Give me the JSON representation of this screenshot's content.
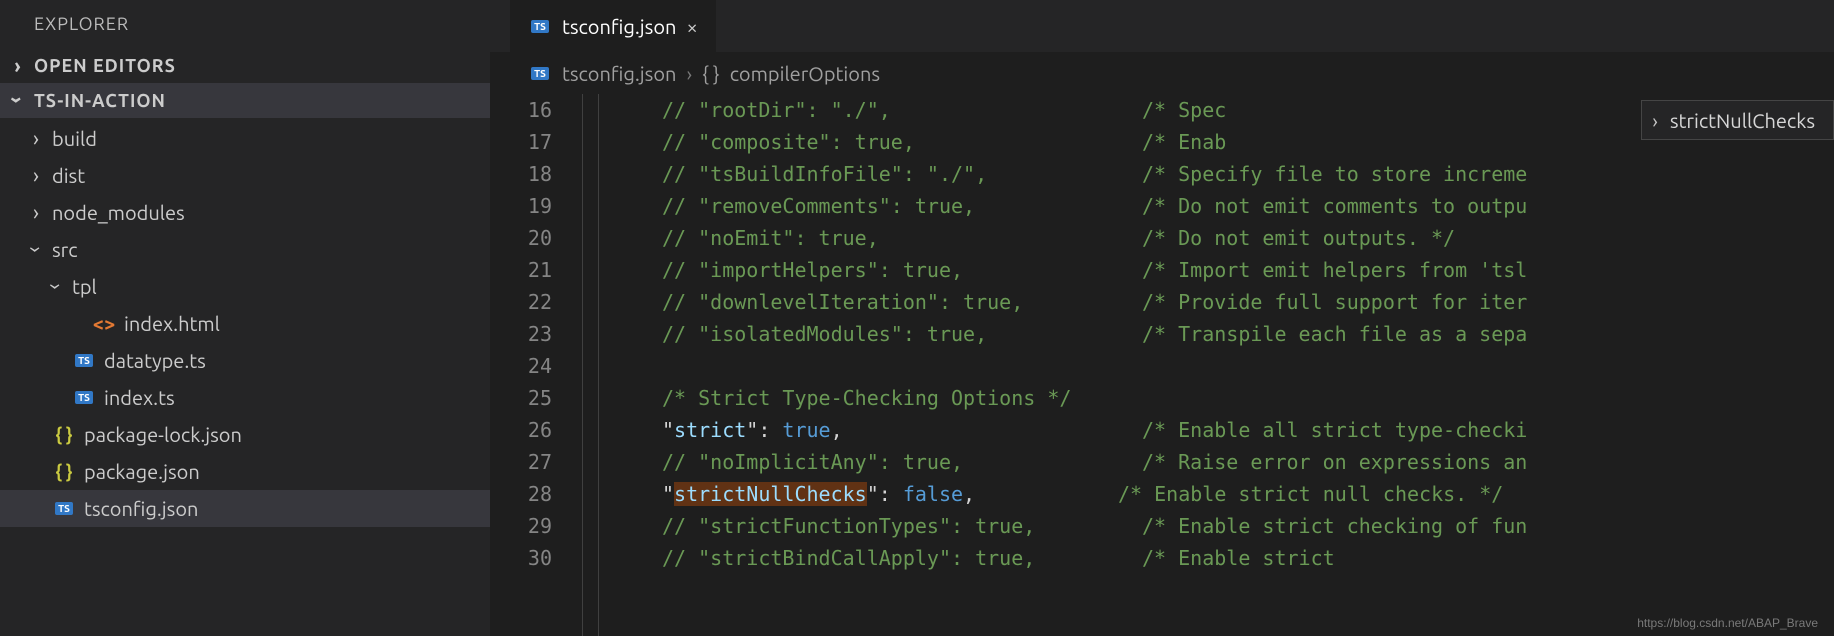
{
  "sidebar": {
    "title": "EXPLORER",
    "sections": {
      "openEditors": {
        "label": "OPEN EDITORS",
        "expanded": false
      },
      "project": {
        "label": "TS-IN-ACTION",
        "expanded": true
      }
    },
    "tree": [
      {
        "depth": 0,
        "kind": "folder",
        "expanded": false,
        "label": "build"
      },
      {
        "depth": 0,
        "kind": "folder",
        "expanded": false,
        "label": "dist"
      },
      {
        "depth": 0,
        "kind": "folder",
        "expanded": false,
        "label": "node_modules"
      },
      {
        "depth": 0,
        "kind": "folder",
        "expanded": true,
        "label": "src"
      },
      {
        "depth": 1,
        "kind": "folder",
        "expanded": true,
        "label": "tpl"
      },
      {
        "depth": 2,
        "kind": "file",
        "icon": "html",
        "label": "index.html"
      },
      {
        "depth": 1,
        "kind": "file",
        "icon": "ts",
        "label": "datatype.ts"
      },
      {
        "depth": 1,
        "kind": "file",
        "icon": "ts",
        "label": "index.ts"
      },
      {
        "depth": 0,
        "kind": "file",
        "icon": "json",
        "label": "package-lock.json"
      },
      {
        "depth": 0,
        "kind": "file",
        "icon": "json",
        "label": "package.json"
      },
      {
        "depth": 0,
        "kind": "file",
        "icon": "ts",
        "label": "tsconfig.json",
        "selected": true
      }
    ]
  },
  "tabs": {
    "active": {
      "icon": "ts",
      "label": "tsconfig.json"
    }
  },
  "breadcrumbs": {
    "file": "tsconfig.json",
    "symbol": "compilerOptions"
  },
  "suggestion": {
    "label": "strictNullChecks"
  },
  "watermark": "https://blog.csdn.net/ABAP_Brave",
  "code": {
    "startLine": 16,
    "lines": [
      {
        "n": 16,
        "tokens": [
          [
            "c-comment",
            "// \"rootDir\": \"./\","
          ]
        ],
        "rcomment": "/* Spec"
      },
      {
        "n": 17,
        "tokens": [
          [
            "c-comment",
            "// \"composite\": true,"
          ]
        ],
        "rcomment": "/* Enab"
      },
      {
        "n": 18,
        "tokens": [
          [
            "c-comment",
            "// \"tsBuildInfoFile\": \"./\","
          ]
        ],
        "rcomment": "/* Specify file to store increme"
      },
      {
        "n": 19,
        "tokens": [
          [
            "c-comment",
            "// \"removeComments\": true,"
          ]
        ],
        "rcomment": "/* Do not emit comments to outpu"
      },
      {
        "n": 20,
        "tokens": [
          [
            "c-comment",
            "// \"noEmit\": true,"
          ]
        ],
        "rcomment": "/* Do not emit outputs. */"
      },
      {
        "n": 21,
        "tokens": [
          [
            "c-comment",
            "// \"importHelpers\": true,"
          ]
        ],
        "rcomment": "/* Import emit helpers from 'tsl"
      },
      {
        "n": 22,
        "tokens": [
          [
            "c-comment",
            "// \"downlevelIteration\": true,"
          ]
        ],
        "rcomment": "/* Provide full support for iter"
      },
      {
        "n": 23,
        "tokens": [
          [
            "c-comment",
            "// \"isolatedModules\": true,"
          ]
        ],
        "rcomment": "/* Transpile each file as a sepa"
      },
      {
        "n": 24,
        "tokens": []
      },
      {
        "n": 25,
        "tokens": [
          [
            "c-comment",
            "/* Strict Type-Checking Options */"
          ]
        ]
      },
      {
        "n": 26,
        "tokens": [
          [
            "c-punc",
            "\""
          ],
          [
            "c-key",
            "strict"
          ],
          [
            "c-punc",
            "\": "
          ],
          [
            "c-bool",
            "true"
          ],
          [
            "c-punc",
            ","
          ]
        ],
        "rcomment": "/* Enable all strict type-checki"
      },
      {
        "n": 27,
        "tokens": [
          [
            "c-comment",
            "// \"noImplicitAny\": true,"
          ]
        ],
        "rcomment": "/* Raise error on expressions an"
      },
      {
        "n": 28,
        "tokens": [
          [
            "c-punc",
            "\""
          ],
          [
            "c-key c-hl",
            "strictNullChecks"
          ],
          [
            "c-punc",
            "\": "
          ],
          [
            "c-bool",
            "false"
          ],
          [
            "c-punc",
            ","
          ]
        ],
        "rcomment_near": "/* Enable strict null checks. */"
      },
      {
        "n": 29,
        "tokens": [
          [
            "c-comment",
            "// \"strictFunctionTypes\": true,"
          ]
        ],
        "rcomment": "/* Enable strict checking of fun"
      },
      {
        "n": 30,
        "tokens": [
          [
            "c-comment",
            "// \"strictBindCallApply\": true,"
          ]
        ],
        "rcomment": "/* Enable strict"
      }
    ]
  }
}
